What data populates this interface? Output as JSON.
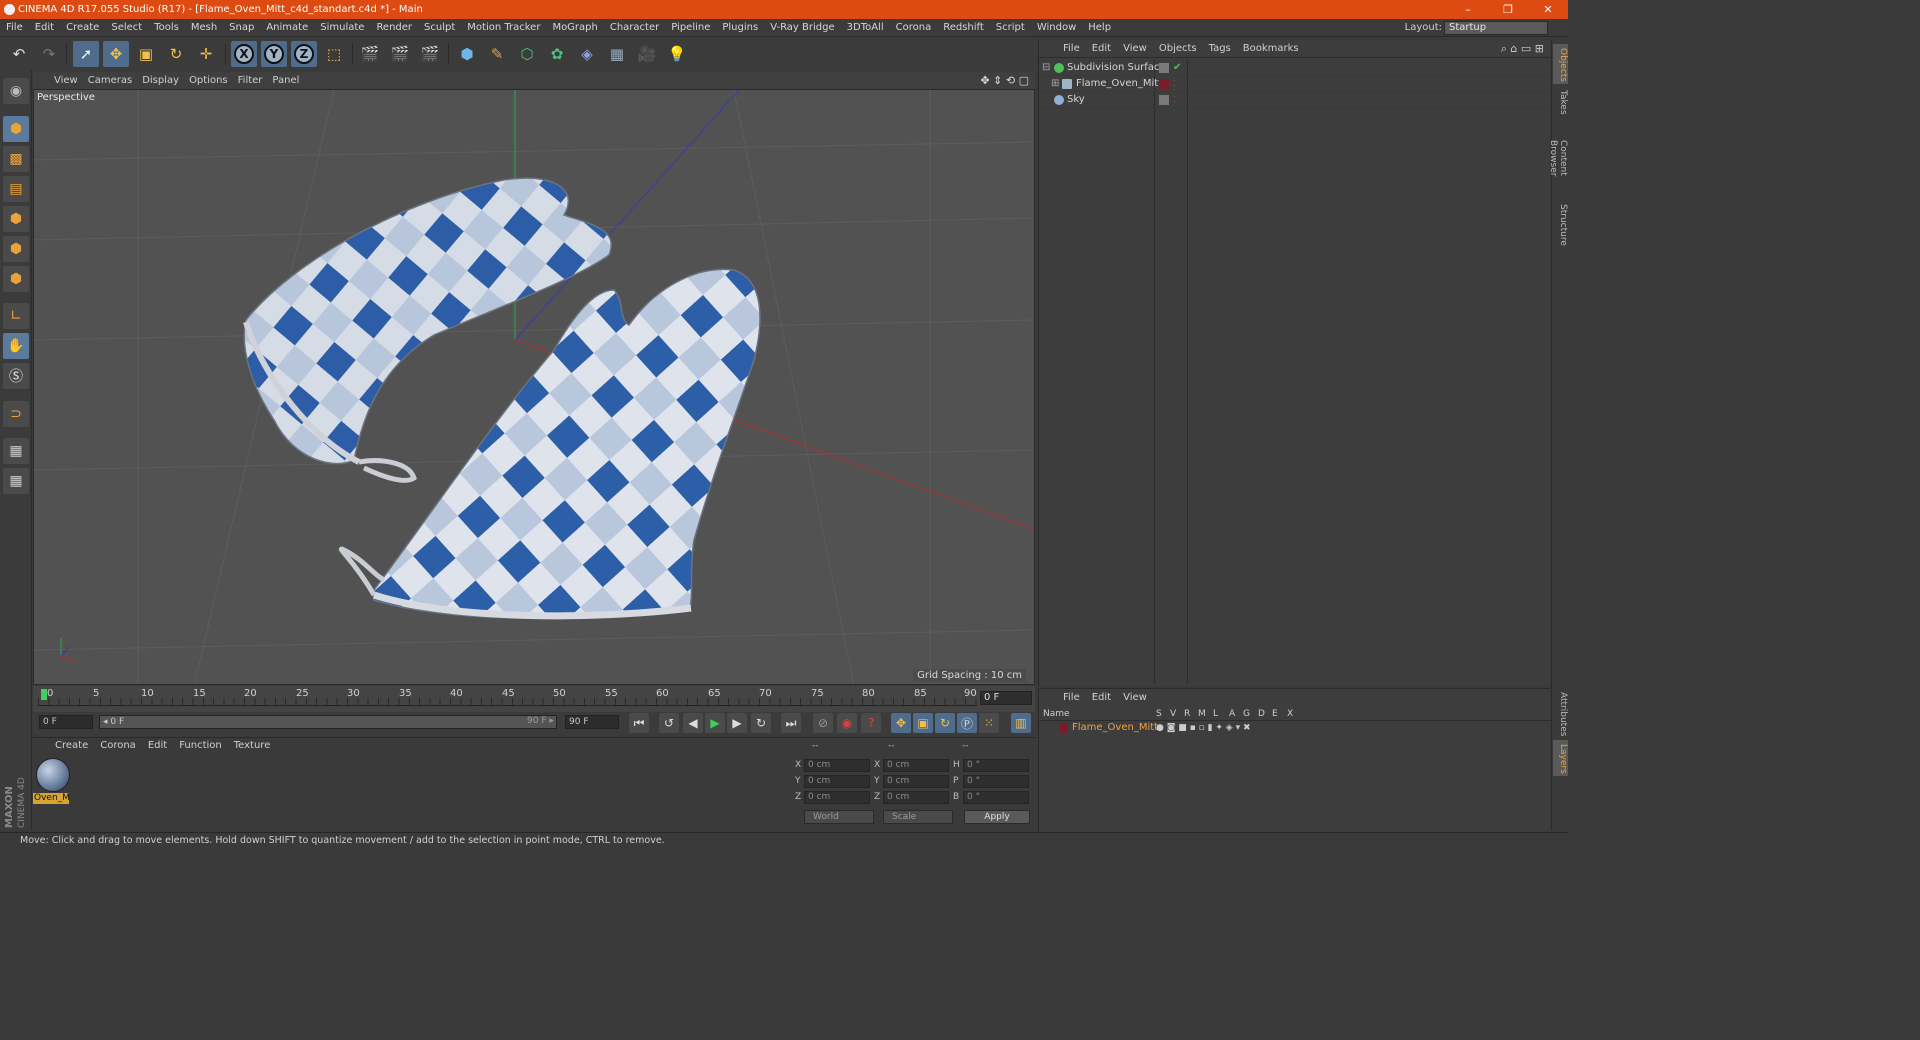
{
  "app": {
    "title": "CINEMA 4D R17.055 Studio (R17) - [Flame_Oven_Mitt_c4d_standart.c4d *] - Main",
    "window_controls": [
      "–",
      "❐",
      "✕"
    ]
  },
  "menu": [
    "File",
    "Edit",
    "Create",
    "Select",
    "Tools",
    "Mesh",
    "Snap",
    "Animate",
    "Simulate",
    "Render",
    "Sculpt",
    "Motion Tracker",
    "MoGraph",
    "Character",
    "Pipeline",
    "Plugins",
    "V-Ray Bridge",
    "3DToAll",
    "Corona",
    "Redshift",
    "Script",
    "Window",
    "Help"
  ],
  "layout": {
    "label": "Layout:",
    "value": "Startup"
  },
  "viewport": {
    "menu": [
      "View",
      "Cameras",
      "Display",
      "Options",
      "Filter",
      "Panel"
    ],
    "label": "Perspective",
    "grid_spacing": "Grid Spacing : 10 cm"
  },
  "timeline": {
    "ticks": [
      "0",
      "5",
      "10",
      "15",
      "20",
      "25",
      "30",
      "35",
      "40",
      "45",
      "50",
      "55",
      "60",
      "65",
      "70",
      "75",
      "80",
      "85",
      "90"
    ],
    "current_frame": "0 F"
  },
  "transport": {
    "start": "0 F",
    "range_start": "◂ 0 F",
    "range_end": "90 F ▸",
    "end": "90 F"
  },
  "material_manager": {
    "menu": [
      "Create",
      "Corona",
      "Edit",
      "Function",
      "Texture"
    ],
    "material_name": "Oven_M"
  },
  "coordinates": {
    "headers": [
      "--",
      "--",
      "--"
    ],
    "rows": [
      {
        "a": "X",
        "av": "0 cm",
        "b": "X",
        "bv": "0 cm",
        "c": "H",
        "cv": "0 °"
      },
      {
        "a": "Y",
        "av": "0 cm",
        "b": "Y",
        "bv": "0 cm",
        "c": "P",
        "cv": "0 °"
      },
      {
        "a": "Z",
        "av": "0 cm",
        "b": "Z",
        "bv": "0 cm",
        "c": "B",
        "cv": "0 °"
      }
    ],
    "mode": "World",
    "type": "Scale",
    "apply": "Apply"
  },
  "status": "Move: Click and drag to move elements. Hold down SHIFT to quantize movement / add to the selection in point mode, CTRL to remove.",
  "object_manager": {
    "menu": [
      "File",
      "Edit",
      "View",
      "Objects",
      "Tags",
      "Bookmarks"
    ],
    "objects": [
      {
        "name": "Subdivision Surface",
        "icon_color": "#4fbf5a"
      },
      {
        "name": "Flame_Oven_Mitt",
        "icon_color": "#9fb4c8"
      },
      {
        "name": "Sky",
        "icon_color": "#8fb0d8"
      }
    ]
  },
  "layer_manager": {
    "menu": [
      "File",
      "Edit",
      "View"
    ],
    "columns": [
      "Name",
      "S",
      "V",
      "R",
      "M",
      "L",
      "A",
      "G",
      "D",
      "E",
      "X"
    ],
    "layer": "Flame_Oven_Mitt"
  },
  "right_tabs": [
    "Objects",
    "Takes",
    "Content Browser",
    "Structure",
    "Attributes",
    "Layers"
  ],
  "colors": {
    "accent": "#dd4b12",
    "selection": "#f0a23a",
    "tool_active": "#4f6c8c"
  }
}
